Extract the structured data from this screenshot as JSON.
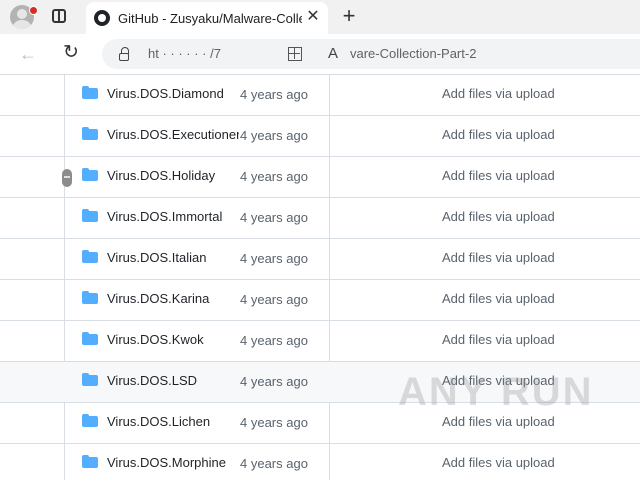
{
  "browser": {
    "tab_title": "GitHub - Zusyaku/Malware-Collec",
    "tab_close": "✕",
    "new_tab": "+",
    "back": "←",
    "reload": "↻",
    "url_text": "ht  ·  ·  ·  ·  ·  ·  /7",
    "readaloud": "A",
    "url_tail": "vare-Collection-Part-2"
  },
  "file_list": {
    "rows": [
      {
        "name": "Virus.DOS.Diamond",
        "message": "Add files via upload",
        "age": "4 years ago"
      },
      {
        "name": "Virus.DOS.Executioner",
        "message": "Add files via upload",
        "age": "4 years ago"
      },
      {
        "name": "Virus.DOS.Holiday",
        "message": "Add files via upload",
        "age": "4 years ago"
      },
      {
        "name": "Virus.DOS.Immortal",
        "message": "Add files via upload",
        "age": "4 years ago"
      },
      {
        "name": "Virus.DOS.Italian",
        "message": "Add files via upload",
        "age": "4 years ago"
      },
      {
        "name": "Virus.DOS.Karina",
        "message": "Add files via upload",
        "age": "4 years ago"
      },
      {
        "name": "Virus.DOS.Kwok",
        "message": "Add files via upload",
        "age": "4 years ago"
      },
      {
        "name": "Virus.DOS.LSD",
        "message": "Add files via upload",
        "age": "4 years ago"
      },
      {
        "name": "Virus.DOS.Lichen",
        "message": "Add files via upload",
        "age": "4 years ago"
      },
      {
        "name": "Virus.DOS.Morphine",
        "message": "Add files via upload",
        "age": "4 years ago"
      }
    ]
  },
  "watermark": "ANY RUN",
  "colors": {
    "folder": "#54aeff",
    "border": "#d8dee4",
    "muted_text": "#59636e"
  },
  "icons": {
    "folder": "folder-icon",
    "github": "github-icon",
    "lock": "site-info-icon"
  }
}
